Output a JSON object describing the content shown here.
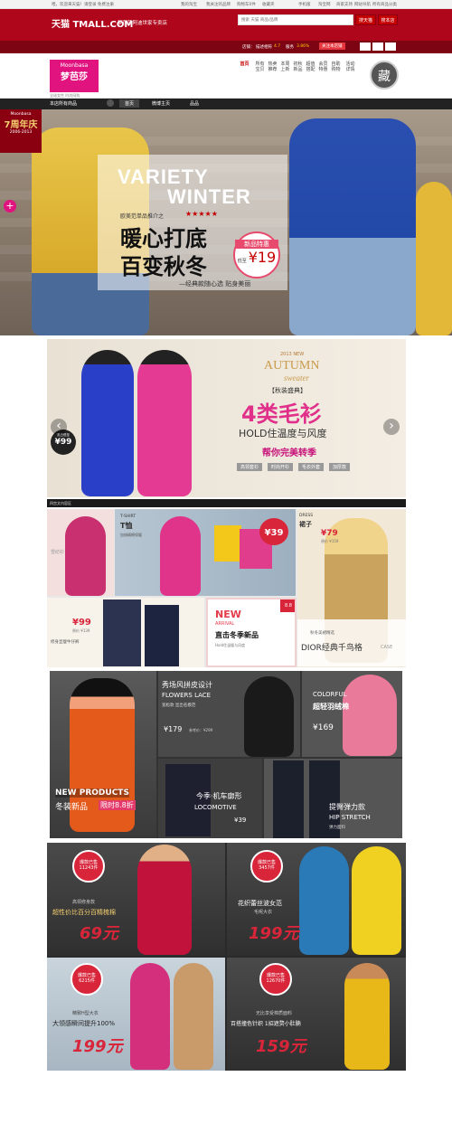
{
  "topbar": {
    "greeting": "喂，欢迎来天猫！请登录 免费注册",
    "links": [
      "我的淘宝",
      "我关注的品牌",
      "购物车0件",
      "收藏夹",
      "手机版",
      "淘宝网",
      "商家支持",
      "网站导航",
      "所有商品分类"
    ]
  },
  "header": {
    "logo_text": "天猫 TMALL.COM",
    "store_name": "梦芭莎阿迪世家专卖店",
    "search_placeholder": "搜索 天猫 商品/品牌",
    "search_btn": "搜天猫",
    "search_store_btn": "搜本店"
  },
  "shopbar": {
    "rating_label": "店铺：",
    "desc_label": "描述相符",
    "desc_score": "4.7",
    "service_label": "服务",
    "service_score": "3.86%",
    "follow_btn": "关注本店铺"
  },
  "brand": {
    "logo_en": "Moonbasa",
    "logo_cn": "梦芭莎",
    "slogan": "全球女性 时尚网购",
    "nav": [
      "首页",
      "所有宝贝",
      "热卖推荐",
      "本周上新",
      "初秋新品",
      "超值搭配",
      "会员特惠",
      "自助购物",
      "活动详情"
    ],
    "collect": "藏"
  },
  "navbar": {
    "items": [
      "本店所有商品",
      "首页",
      "微博主页",
      "品品"
    ]
  },
  "banner1": {
    "anniv_brand": "Moonbasa",
    "anniv_big": "7周年庆",
    "anniv_years": "2006-2013",
    "title_en1": "VARIETY",
    "title_en2": "WINTER",
    "sub_label": "欧美范单品推介之",
    "stars": "★★★★★",
    "title_cn1": "暖心打底",
    "title_cn2": "百变秋冬",
    "tagline": "—经典款随心选  贴身美丽",
    "badge_top": "新品特惠",
    "badge_low": "低至",
    "badge_price": "¥19"
  },
  "banner2": {
    "year": "2013 NEW",
    "autumn": "AUTUMN",
    "sweater": "sweater",
    "event": "【秋装盛典】",
    "big_title": "4类毛衫",
    "hold": "HOLD住温度与风度",
    "help": "帮你完美转季",
    "tags": [
      "高领套衫",
      "时尚开衫",
      "毛衣外套",
      "加厚款"
    ],
    "price_label": "黑白低至",
    "price": "¥99",
    "prev": "‹",
    "next": "›"
  },
  "section_label": "四宫文内容区",
  "grid3": {
    "c1_title": "雪纺衫",
    "c2_en": "T-SHIRT",
    "c2_cn": "T恤",
    "c2_desc": "加绒精棉保暖",
    "c2_price": "¥39",
    "c3_en": "DRESS",
    "c3_cn": "裙子",
    "c3_price": "¥79",
    "c3_orig": "原价 ¥159",
    "c4_price": "¥99",
    "c4_orig": "原价 ¥139",
    "c4_desc": "修身显瘦牛仔裤",
    "c5_new": "NEW",
    "c5_arrival": "ARRIVAL",
    "c5_cn": "直击冬季新品",
    "c5_sub": "Hold住温暖与风度",
    "c5_badge": "8.8",
    "c6_sub": "秋冬美裙精选",
    "c6_title": "DIOR经典千鸟格",
    "c6_case": "CASE"
  },
  "grid4": {
    "c1_en": "NEW PRODUCTS",
    "c1_cn": "冬装新品",
    "c1_tag": "限时8.8折",
    "c2_cn": "秀场风拼皮设计",
    "c2_en": "FLOWERS LACE",
    "c2_sub": "宽松款 显出名模范",
    "c2_price": "¥179",
    "c2_orig": "参考价：¥299",
    "c3_en": "COLORFUL",
    "c3_cn": "超轻羽绒棉",
    "c3_price": "¥169",
    "c4_cn": "今季·机车廓形",
    "c4_en": "LOCOMOTIVE",
    "c4_price": "¥39",
    "c5_cn": "提臀弹力款",
    "c5_en": "HIP STRETCH",
    "c5_sub": "弹力面料"
  },
  "grid5": {
    "c1_badge1": "爆款已售",
    "c1_count": "11243件",
    "c1_sub": "高领修身款",
    "c1_title": "超性价比百分百精梳棉",
    "c1_price": "69元",
    "c2_badge1": "爆款已售",
    "c2_count": "3457件",
    "c2_sub": "花织蕾丝波女范",
    "c2_title": "毛呢大衣",
    "c2_price": "199元",
    "c3_badge1": "爆款已售",
    "c3_count": "6215件",
    "c3_sub": "精致H型大衣",
    "c3_title": "大领感瞬间提升100%",
    "c3_price": "199元",
    "c4_badge1": "爆款已售",
    "c4_count": "12670件",
    "c4_sub": "无比享受棉质面料",
    "c4_title": "百搭撞色针织 1招遮赘小肚腩",
    "c4_price": "159元"
  }
}
